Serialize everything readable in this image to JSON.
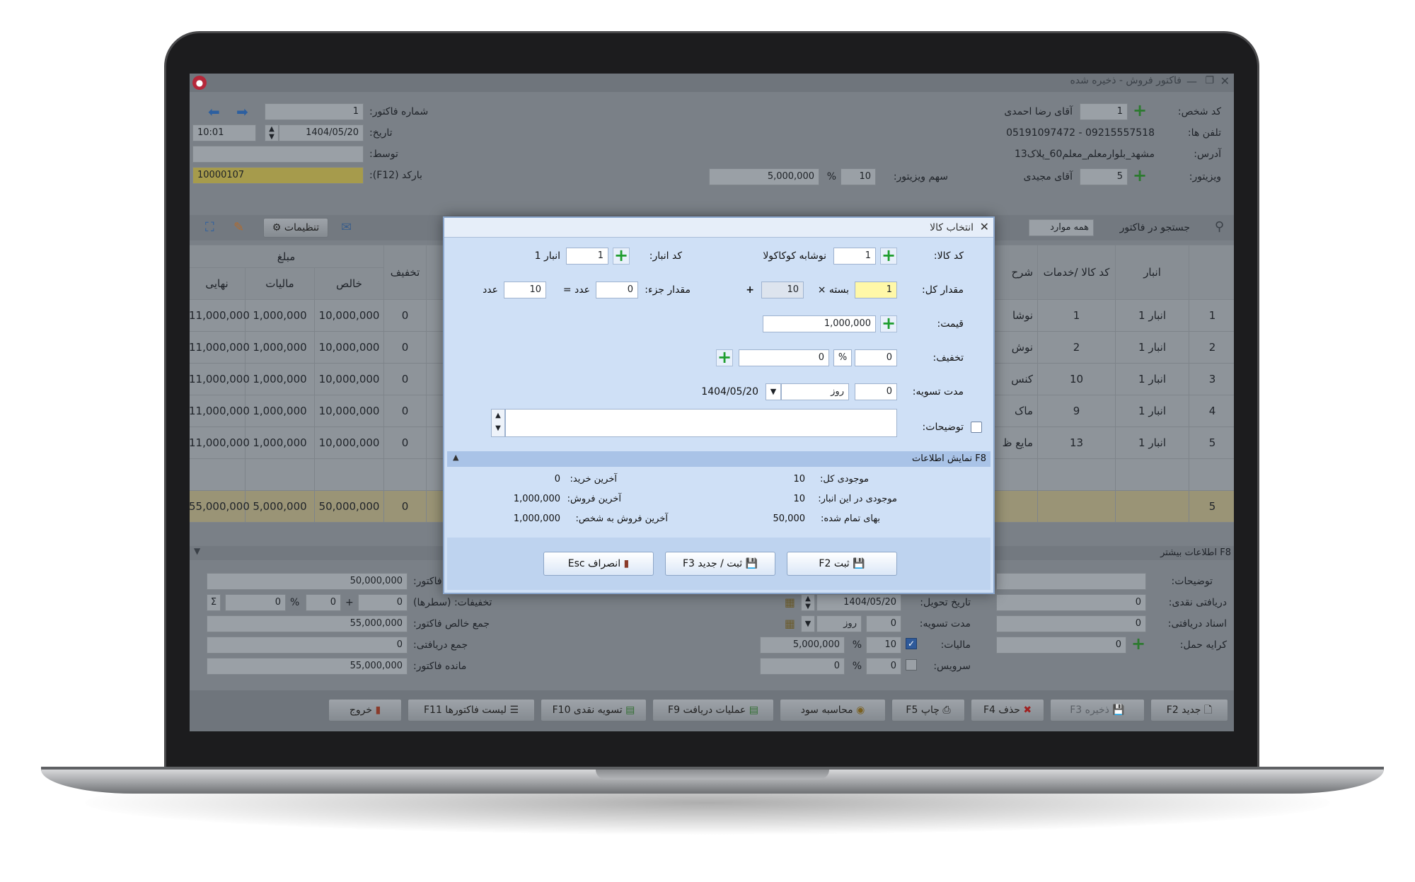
{
  "window": {
    "title": "فاکتور فروش - ذخیره شده"
  },
  "header": {
    "invoice_number_label": "شماره فاکتور:",
    "invoice_number": "1",
    "date_label": "تاریخ:",
    "date": "1404/05/20",
    "time": "10:01",
    "by_label": "توسط:",
    "by_value": "",
    "barcode_label": "بارکد (F12):",
    "barcode_value": "10000107",
    "person_code_label": "کد شخص:",
    "person_code": "1",
    "person_name": "آقای رضا احمدی",
    "phones_label": "تلفن ها:",
    "phones": "05191097472 - 09215557518",
    "address_label": "آدرس:",
    "address": "مشهد_بلوارمعلم_معلم60_پلاک13",
    "visitor_label": "ویزیتور:",
    "visitor_code": "5",
    "visitor_name": "آقای مجیدی",
    "visitor_share_label": "سهم ویزیتور:",
    "visitor_share_percent": "10",
    "visitor_share_amount": "5,000,000",
    "percent_sign": "%"
  },
  "toolbar": {
    "settings": "تنظیمات",
    "search_label": "جستجو در فاکتور",
    "search_scope": "همه موارد"
  },
  "grid": {
    "amount_group": "مبلغ",
    "headers": {
      "final": "نهایی",
      "tax": "مالیات",
      "net": "خالص",
      "discount": "تخفیف",
      "desc": "شرح",
      "code": "کد کالا /خدمات",
      "warehouse": "انبار"
    },
    "rows": [
      {
        "n": "1",
        "warehouse": "انبار 1",
        "code": "1",
        "desc": "نوشا",
        "discount": "0",
        "net": "10,000,000",
        "tax": "1,000,000",
        "final": "11,000,000"
      },
      {
        "n": "2",
        "warehouse": "انبار 1",
        "code": "2",
        "desc": "نوش",
        "discount": "0",
        "net": "10,000,000",
        "tax": "1,000,000",
        "final": "11,000,000"
      },
      {
        "n": "3",
        "warehouse": "انبار 1",
        "code": "10",
        "desc": "کنس",
        "discount": "0",
        "net": "10,000,000",
        "tax": "1,000,000",
        "final": "11,000,000"
      },
      {
        "n": "4",
        "warehouse": "انبار 1",
        "code": "9",
        "desc": "ماک",
        "discount": "0",
        "net": "10,000,000",
        "tax": "1,000,000",
        "final": "11,000,000"
      },
      {
        "n": "5",
        "warehouse": "انبار 1",
        "code": "13",
        "desc": "مایع ظ",
        "discount": "0",
        "net": "10,000,000",
        "tax": "1,000,000",
        "final": "11,000,000"
      }
    ],
    "totals": {
      "n": "5",
      "discount": "0",
      "net": "50,000,000",
      "tax": "5,000,000",
      "final": "55,000,000"
    }
  },
  "more_info": {
    "title": "F8 اطلاعات بیشتر",
    "notes_label": "توضیحات:",
    "cash_received_label": "دریافتی نقدی:",
    "cash_received": "0",
    "docs_received_label": "اسناد دریافتی:",
    "docs_received": "0",
    "shipping_label": "کرایه حمل:",
    "shipping": "0",
    "delivery_date_label": "تاریخ تحویل:",
    "delivery_date": "1404/05/20",
    "settle_label": "مدت تسویه:",
    "settle_days": "0",
    "settle_unit": "روز",
    "tax_label": "مالیات:",
    "tax_percent": "10",
    "tax_amount": "5,000,000",
    "service_label": "سرویس:",
    "service_percent": "0",
    "service_amount": "0",
    "invoice_label": "فاکتور:",
    "invoice_amount": "50,000,000",
    "discounts_label": "تخفیفات: (سطرها)",
    "discount_rows": "0",
    "discount_extra": "0",
    "discount_percent": "0",
    "net_total_label": "جمع خالص فاکتور:",
    "net_total": "55,000,000",
    "received_total_label": "جمع دریافتی:",
    "received_total": "0",
    "remaining_label": "مانده فاکتور:",
    "remaining": "55,000,000",
    "sigma": "Σ",
    "plus": "+"
  },
  "footer_buttons": {
    "new": "جدید F2",
    "save": "ذخیره F3",
    "delete": "حذف F4",
    "print": "چاپ F5",
    "profit": "محاسبه سود",
    "receive_ops": "عملیات دریافت F9",
    "cash_settle": "تسویه نقدی F10",
    "invoice_list": "لیست فاکتورها F11",
    "exit": "خروج"
  },
  "dialog": {
    "title": "انتخاب کالا",
    "item_code_label": "کد کالا:",
    "item_code": "1",
    "item_name": "نوشابه کوکاکولا",
    "wh_code_label": "کد انبار:",
    "wh_code": "1",
    "wh_name": "انبار 1",
    "total_qty_label": "مقدار کل:",
    "total_qty": "1",
    "pack_label": "بسته ×",
    "pack_size": "10",
    "plus_sign": "+",
    "partial_label": "مقدار جزء:",
    "partial_qty": "0",
    "unit_label": "عدد",
    "equals_label": "عدد =",
    "result_qty": "10",
    "price_label": "قیمت:",
    "price": "1,000,000",
    "discount_label": "تخفیف:",
    "discount_percent": "0",
    "discount_amount": "0",
    "percent_sign": "%",
    "settle_label": "مدت تسویه:",
    "settle_days": "0",
    "settle_unit": "روز",
    "settle_date": "1404/05/20",
    "notes_label": "توضیحات:",
    "info_bar": "F8 نمایش اطلاعات",
    "stock_total_label": "موجودی کل:",
    "stock_total": "10",
    "stock_wh_label": "موجودی در این انبار:",
    "stock_wh": "10",
    "cost_label": "بهای تمام شده:",
    "cost": "50,000",
    "last_buy_label": "آخرین خرید:",
    "last_buy": "0",
    "last_sell_label": "آخرین فروش:",
    "last_sell": "1,000,000",
    "last_sell_person_label": "آخرین فروش به شخص:",
    "last_sell_person": "1,000,000",
    "btn_save": "ثبت F2",
    "btn_save_new": "ثبت / جدید F3",
    "btn_cancel": "انصراف Esc"
  }
}
